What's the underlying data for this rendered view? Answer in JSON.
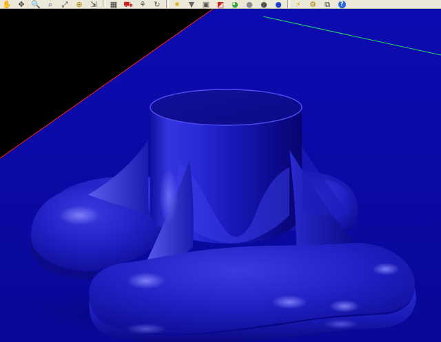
{
  "colors": {
    "background": "#000000",
    "plane": "#0b0aa8",
    "model_mid": "#2424d0",
    "model_light": "#6a6af0",
    "model_dark": "#07056a",
    "axis_x": "#ff2a2a",
    "axis_y": "#22dd66",
    "toolbar_bg": "#ece9d8"
  },
  "toolbar": {
    "items": [
      {
        "icon": "pan-hand-icon",
        "glyph": "✋",
        "color": "#7a6a3a"
      },
      {
        "icon": "move-icon",
        "glyph": "✥",
        "color": "#444444"
      },
      {
        "icon": "zoom-icon",
        "glyph": "🔍",
        "color": "#334488"
      },
      {
        "icon": "zoom-window-icon",
        "glyph": "⌕",
        "color": "#334488"
      },
      {
        "icon": "zoom-extents-icon",
        "glyph": "⤢",
        "color": "#333333"
      },
      {
        "icon": "zoom-selected-icon",
        "glyph": "⊕",
        "color": "#aa8800"
      },
      {
        "icon": "zoom-dynamic-icon",
        "glyph": "⇲",
        "color": "#333333"
      },
      {
        "icon": "grid-icon",
        "glyph": "▦",
        "color": "#333333"
      },
      {
        "icon": "car-icon",
        "glyph": "⛟",
        "color": "#cc2222"
      },
      {
        "icon": "walk-icon",
        "glyph": "⚘",
        "color": "#555555"
      },
      {
        "icon": "rotate-icon",
        "glyph": "↻",
        "color": "#555555"
      },
      {
        "icon": "light-bulb-icon",
        "glyph": "✷",
        "color": "#ddaa00"
      },
      {
        "icon": "funnel-icon",
        "glyph": "▼",
        "color": "#666666"
      },
      {
        "icon": "box-icon",
        "glyph": "▣",
        "color": "#555555"
      },
      {
        "icon": "color-cube-icon",
        "glyph": "◩",
        "color": "#cc2222"
      },
      {
        "icon": "color-wheel-icon",
        "glyph": "◕",
        "color": "#33aa33"
      },
      {
        "icon": "sphere-gray-icon",
        "glyph": "●",
        "color": "#888888"
      },
      {
        "icon": "sphere-dark-icon",
        "glyph": "●",
        "color": "#555555"
      },
      {
        "icon": "sphere-blue-icon",
        "glyph": "●",
        "color": "#2244cc"
      },
      {
        "icon": "wand-icon",
        "glyph": "⚡",
        "color": "#ddaa00"
      },
      {
        "icon": "gear-icon",
        "glyph": "⚙",
        "color": "#aa8800"
      },
      {
        "icon": "layout-icon",
        "glyph": "⧉",
        "color": "#333333"
      },
      {
        "icon": "help-icon",
        "glyph": "?",
        "color": "#ffffff"
      }
    ]
  }
}
